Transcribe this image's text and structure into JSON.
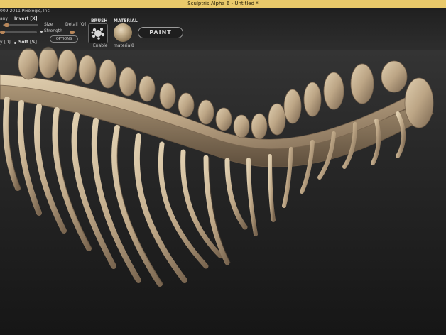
{
  "window": {
    "title": "Sculptris Alpha 6 - Untitled *"
  },
  "toolbar": {
    "copyright": "009-2011 Pixologic, Inc.",
    "any_label": "any",
    "invert_label": "Invert [X]",
    "size_label": "Size",
    "detail_label": "Detail [Q]",
    "strength_label": "Strength",
    "options_label": "OPTIONS",
    "lazy_label": "y [D]",
    "soft_label": "Soft [S]",
    "brush_header": "BRUSH",
    "brush_enable_label": "Enable",
    "material_header": "MATERIAL",
    "material_name": "material8",
    "paint_label": "PAINT"
  },
  "colors": {
    "title_bar": "#e9c96a",
    "bone": "#c7b392",
    "background_top": "#3a3a3a",
    "background_bottom": "#161616"
  },
  "icons": [
    "brush-icon",
    "material-sphere-icon"
  ]
}
